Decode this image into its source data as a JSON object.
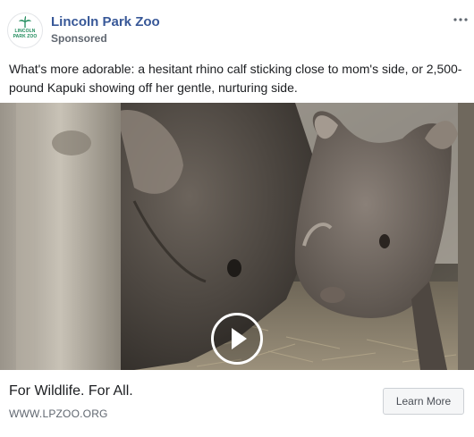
{
  "post": {
    "page_name": "Lincoln Park Zoo",
    "sponsored_label": "Sponsored",
    "more_icon": "more-dots-icon",
    "caption": "What's more adorable: a hesitant rhino calf sticking close to mom's side, or 2,500-pound Kapuki showing off her gentle, nurturing side.",
    "avatar": {
      "logo_line1": "LINCOLN",
      "logo_line2": "PARK ZOO",
      "icon": "zoo-logo-icon",
      "brand_color": "#1e8a5a"
    }
  },
  "video": {
    "play_icon": "play-icon"
  },
  "link": {
    "headline": "For Wildlife. For All.",
    "domain": "WWW.LPZOO.ORG",
    "cta_label": "Learn More"
  },
  "colors": {
    "page_name": "#385898",
    "secondary_text": "#606770",
    "button_bg": "#f5f6f7"
  }
}
